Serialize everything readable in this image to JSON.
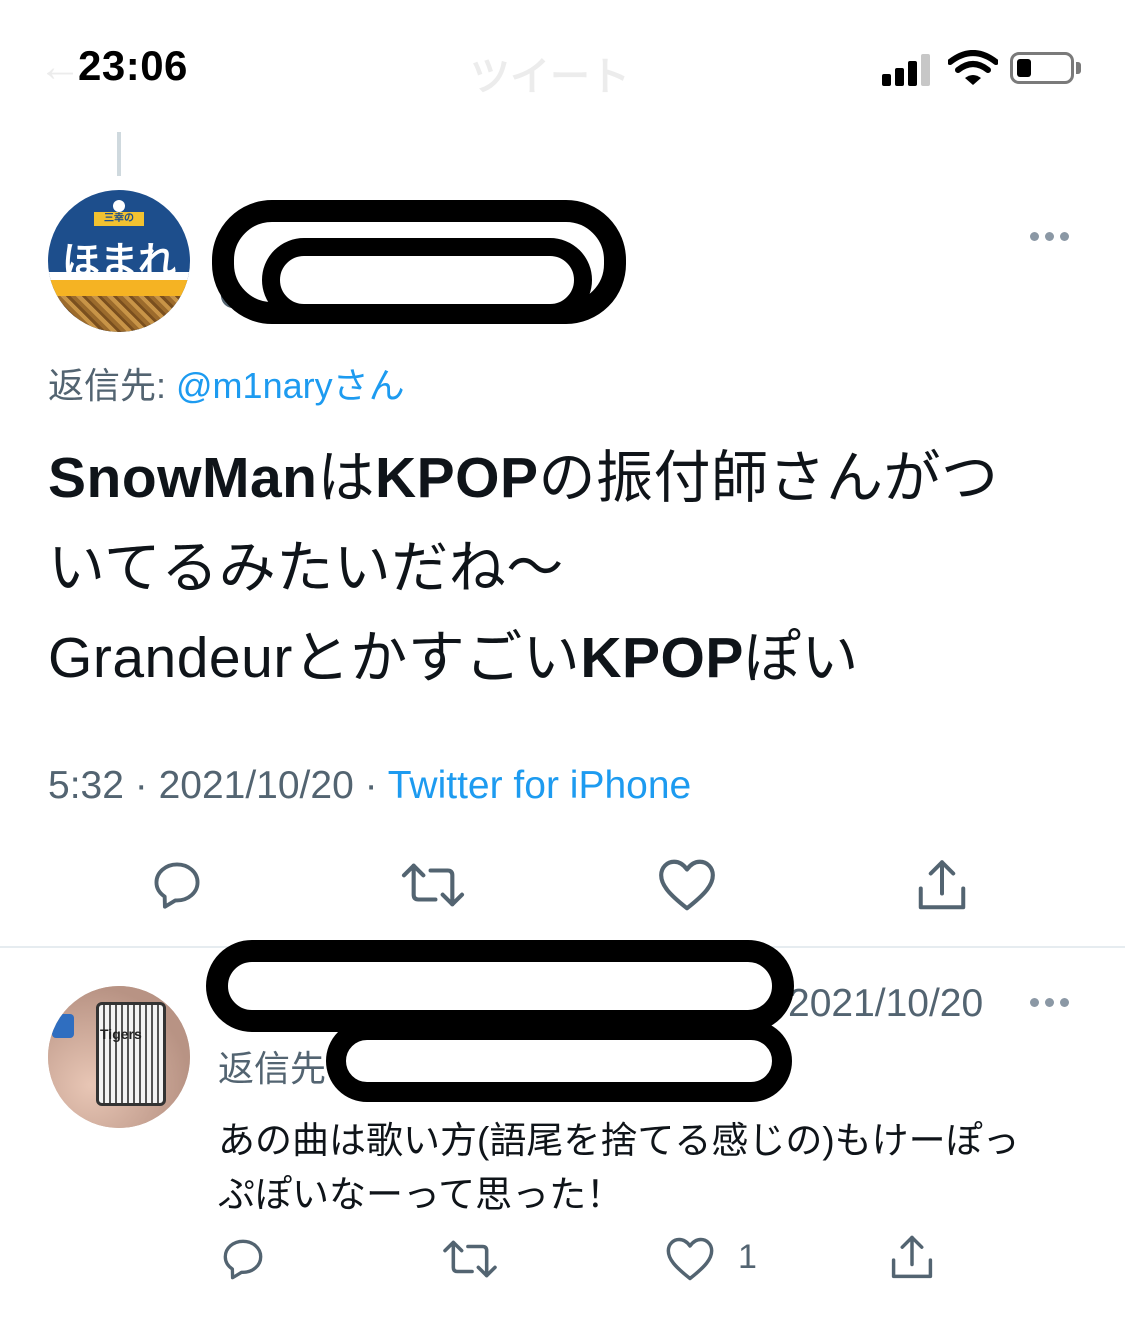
{
  "status_bar": {
    "time": "23:06"
  },
  "nav": {
    "title": "ツイート",
    "back": "←"
  },
  "main_tweet": {
    "handle_prefix": "@",
    "reply_to_label": "返信先: ",
    "reply_to_mention": "@m1naryさん",
    "lines": [
      [
        {
          "text": "SnowMan",
          "bold": true
        },
        {
          "text": "は",
          "bold": false
        },
        {
          "text": "KPOP",
          "bold": true
        },
        {
          "text": "の振付師さんがつ",
          "bold": false
        }
      ],
      [
        {
          "text": "いてるみたいだね〜",
          "bold": false
        }
      ],
      [
        {
          "text": "Grandeurとかすごい",
          "bold": false
        },
        {
          "text": "KPOP",
          "bold": true
        },
        {
          "text": "ぽい",
          "bold": false
        }
      ]
    ],
    "meta_time": "5:32",
    "meta_sep": " · ",
    "meta_date": "2021/10/20",
    "meta_sep2": " · ",
    "meta_source": "Twitter for iPhone"
  },
  "reply_tweet": {
    "date": "2021/10/20",
    "reply_to_label": "返信先",
    "text_line1": "あの曲は歌い方(語尾を捨てる感じの)もけーぽっ",
    "text_line2": "ぷぽいなーって思った！",
    "like_count": "1"
  },
  "colors": {
    "accent": "#1d9bf0",
    "secondary_text": "#536471",
    "icon": "#536471"
  },
  "icons": {
    "reply": "reply-icon",
    "retweet": "retweet-icon",
    "like": "heart-icon",
    "share": "share-icon",
    "more": "more-icon"
  }
}
